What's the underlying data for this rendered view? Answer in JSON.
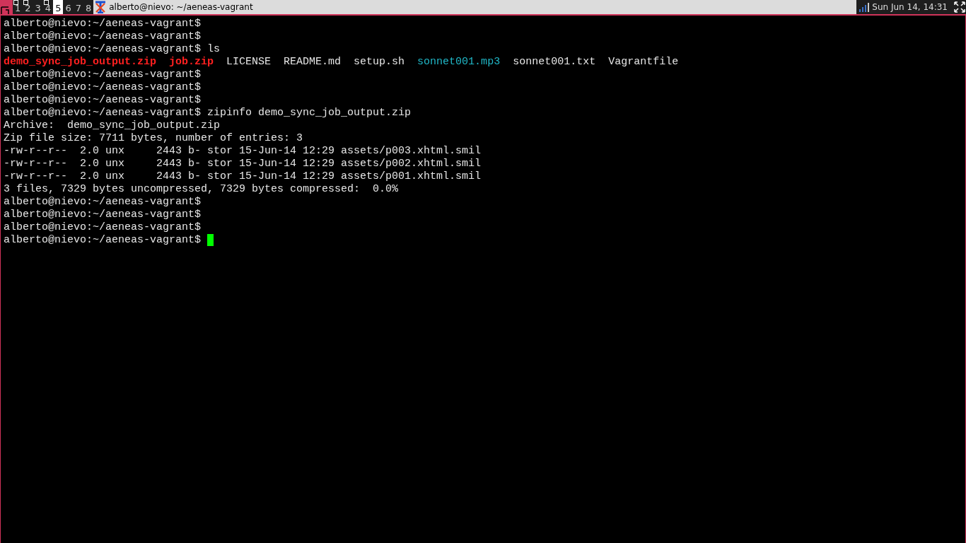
{
  "workspaces": [
    {
      "label": "1",
      "selected": false,
      "occupied": true
    },
    {
      "label": "2",
      "selected": false,
      "occupied": true
    },
    {
      "label": "3",
      "selected": false,
      "occupied": false
    },
    {
      "label": "4",
      "selected": false,
      "occupied": true
    },
    {
      "label": "5",
      "selected": true,
      "occupied": false
    },
    {
      "label": "6",
      "selected": false,
      "occupied": false
    },
    {
      "label": "7",
      "selected": false,
      "occupied": false
    },
    {
      "label": "8",
      "selected": false,
      "occupied": false
    }
  ],
  "window": {
    "title": "alberto@nievo: ~/aeneas-vagrant"
  },
  "clock": "Sun Jun 14, 14:31",
  "terminal": {
    "lines": [
      [
        {
          "kind": "plain",
          "text": "alberto@nievo:~/aeneas-vagrant$"
        }
      ],
      [
        {
          "kind": "plain",
          "text": "alberto@nievo:~/aeneas-vagrant$"
        }
      ],
      [
        {
          "kind": "plain",
          "text": "alberto@nievo:~/aeneas-vagrant$ ls"
        }
      ],
      [
        {
          "kind": "archive",
          "text": "demo_sync_job_output.zip"
        },
        {
          "kind": "archive",
          "text": "job.zip"
        },
        {
          "kind": "plain",
          "text": "LICENSE"
        },
        {
          "kind": "plain",
          "text": "README.md"
        },
        {
          "kind": "plain",
          "text": "setup.sh"
        },
        {
          "kind": "audio",
          "text": "sonnet001.mp3"
        },
        {
          "kind": "plain",
          "text": "sonnet001.txt"
        },
        {
          "kind": "plain",
          "text": "Vagrantfile"
        }
      ],
      [
        {
          "kind": "plain",
          "text": "alberto@nievo:~/aeneas-vagrant$"
        }
      ],
      [
        {
          "kind": "plain",
          "text": "alberto@nievo:~/aeneas-vagrant$"
        }
      ],
      [
        {
          "kind": "plain",
          "text": "alberto@nievo:~/aeneas-vagrant$"
        }
      ],
      [
        {
          "kind": "plain",
          "text": "alberto@nievo:~/aeneas-vagrant$ zipinfo demo_sync_job_output.zip"
        }
      ],
      [
        {
          "kind": "plain",
          "text": "Archive:  demo_sync_job_output.zip"
        }
      ],
      [
        {
          "kind": "plain",
          "text": "Zip file size: 7711 bytes, number of entries: 3"
        }
      ],
      [
        {
          "kind": "plain",
          "text": "-rw-r--r--  2.0 unx     2443 b- stor 15-Jun-14 12:29 assets/p003.xhtml.smil"
        }
      ],
      [
        {
          "kind": "plain",
          "text": "-rw-r--r--  2.0 unx     2443 b- stor 15-Jun-14 12:29 assets/p002.xhtml.smil"
        }
      ],
      [
        {
          "kind": "plain",
          "text": "-rw-r--r--  2.0 unx     2443 b- stor 15-Jun-14 12:29 assets/p001.xhtml.smil"
        }
      ],
      [
        {
          "kind": "plain",
          "text": "3 files, 7329 bytes uncompressed, 7329 bytes compressed:  0.0%"
        }
      ],
      [
        {
          "kind": "plain",
          "text": "alberto@nievo:~/aeneas-vagrant$"
        }
      ],
      [
        {
          "kind": "plain",
          "text": "alberto@nievo:~/aeneas-vagrant$"
        }
      ],
      [
        {
          "kind": "plain",
          "text": "alberto@nievo:~/aeneas-vagrant$"
        }
      ],
      [
        {
          "kind": "prompt",
          "text": "alberto@nievo:~/aeneas-vagrant$"
        }
      ]
    ]
  }
}
